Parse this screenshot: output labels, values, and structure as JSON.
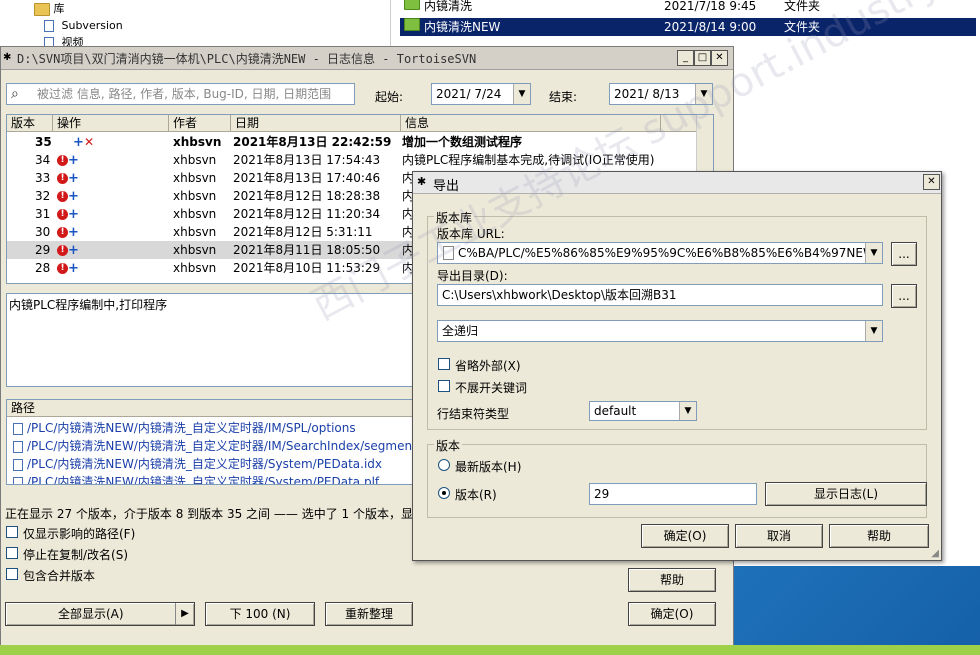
{
  "explorer": {
    "tree": [
      {
        "label": "库"
      },
      {
        "label": "Subversion"
      },
      {
        "label": "视频"
      }
    ],
    "files": [
      {
        "name": "内镜清洗",
        "date": "2021/7/18 9:45",
        "type": "文件夹",
        "selected": false
      },
      {
        "name": "内镜清洗NEW",
        "date": "2021/8/14 9:00",
        "type": "文件夹",
        "selected": true
      }
    ]
  },
  "log": {
    "title": "D:\\SVN项目\\双门清消内镜一体机\\PLC\\内镜清洗NEW - 日志信息 - TortoiseSVN",
    "filter_placeholder": "被过滤 信息, 路径, 作者, 版本, Bug-ID, 日期, 日期范围",
    "from_label": "起始:",
    "from_value": "2021/ 7/24",
    "to_label": "结束:",
    "to_value": "2021/ 8/13",
    "columns": {
      "rev": "版本",
      "action": "操作",
      "author": "作者",
      "date": "日期",
      "message": "信息"
    },
    "rows": [
      {
        "rev": "35",
        "author": "xhbsvn",
        "date": "2021年8月13日 22:42:59",
        "message": "增加一个数组测试程序"
      },
      {
        "rev": "34",
        "author": "xhbsvn",
        "date": "2021年8月13日 17:54:43",
        "message": "内镜PLC程序编制基本完成,待调试(IO正常使用)"
      },
      {
        "rev": "33",
        "author": "xhbsvn",
        "date": "2021年8月13日 17:40:46",
        "message": "内"
      },
      {
        "rev": "32",
        "author": "xhbsvn",
        "date": "2021年8月12日 18:28:38",
        "message": "内"
      },
      {
        "rev": "31",
        "author": "xhbsvn",
        "date": "2021年8月12日 11:20:34",
        "message": "内"
      },
      {
        "rev": "30",
        "author": "xhbsvn",
        "date": "2021年8月12日 5:31:11",
        "message": "内"
      },
      {
        "rev": "29",
        "author": "xhbsvn",
        "date": "2021年8月11日 18:05:50",
        "message": "内"
      },
      {
        "rev": "28",
        "author": "xhbsvn",
        "date": "2021年8月10日 11:53:29",
        "message": "内"
      }
    ],
    "detail_message": "内镜PLC程序编制中,打印程序",
    "paths_header": "路径",
    "paths": [
      "/PLC/内镜清洗NEW/内镜清洗_自定义定时器/IM/SPL/options",
      "/PLC/内镜清洗NEW/内镜清洗_自定义定时器/IM/SearchIndex/segment",
      "/PLC/内镜清洗NEW/内镜清洗_自定义定时器/System/PEData.idx",
      "/PLC/内镜清洗NEW/内镜清洗_自定义定时器/System/PEData.plf"
    ],
    "status": "正在显示 27 个版本，介于版本 8 到版本 35 之间 —— 选中了 1 个版本，显示",
    "checks": [
      {
        "label": "仅显示影响的路径(F)"
      },
      {
        "label": "停止在复制/改名(S)"
      },
      {
        "label": "包含合并版本"
      }
    ],
    "buttons": {
      "show_all": "全部显示(A)",
      "next100": "下 100 (N)",
      "refresh": "重新整理",
      "help": "帮助",
      "ok": "确定(O)"
    }
  },
  "export": {
    "title": "导出",
    "repo_group": "版本库",
    "url_label": "版本库 URL:",
    "url_value": "C%BA/PLC/%E5%86%85%E9%95%9C%E6%B8%85%E6%B4%97NEW",
    "dir_label": "导出目录(D):",
    "dir_value": "C:\\Users\\xhbwork\\Desktop\\版本回溯B31",
    "depth_value": "全递归",
    "omit_externals": "省略外部(X)",
    "no_keywords": "不展开关键词",
    "eol_label": "行结束符类型",
    "eol_value": "default",
    "rev_group": "版本",
    "head_label": "最新版本(H)",
    "rev_label": "版本(R)",
    "rev_value": "29",
    "show_log": "显示日志(L)",
    "ok": "确定(O)",
    "cancel": "取消",
    "help": "帮助",
    "browse": "..."
  },
  "watermark": "西门子工业支持论坛 support.industry.siemens.com"
}
